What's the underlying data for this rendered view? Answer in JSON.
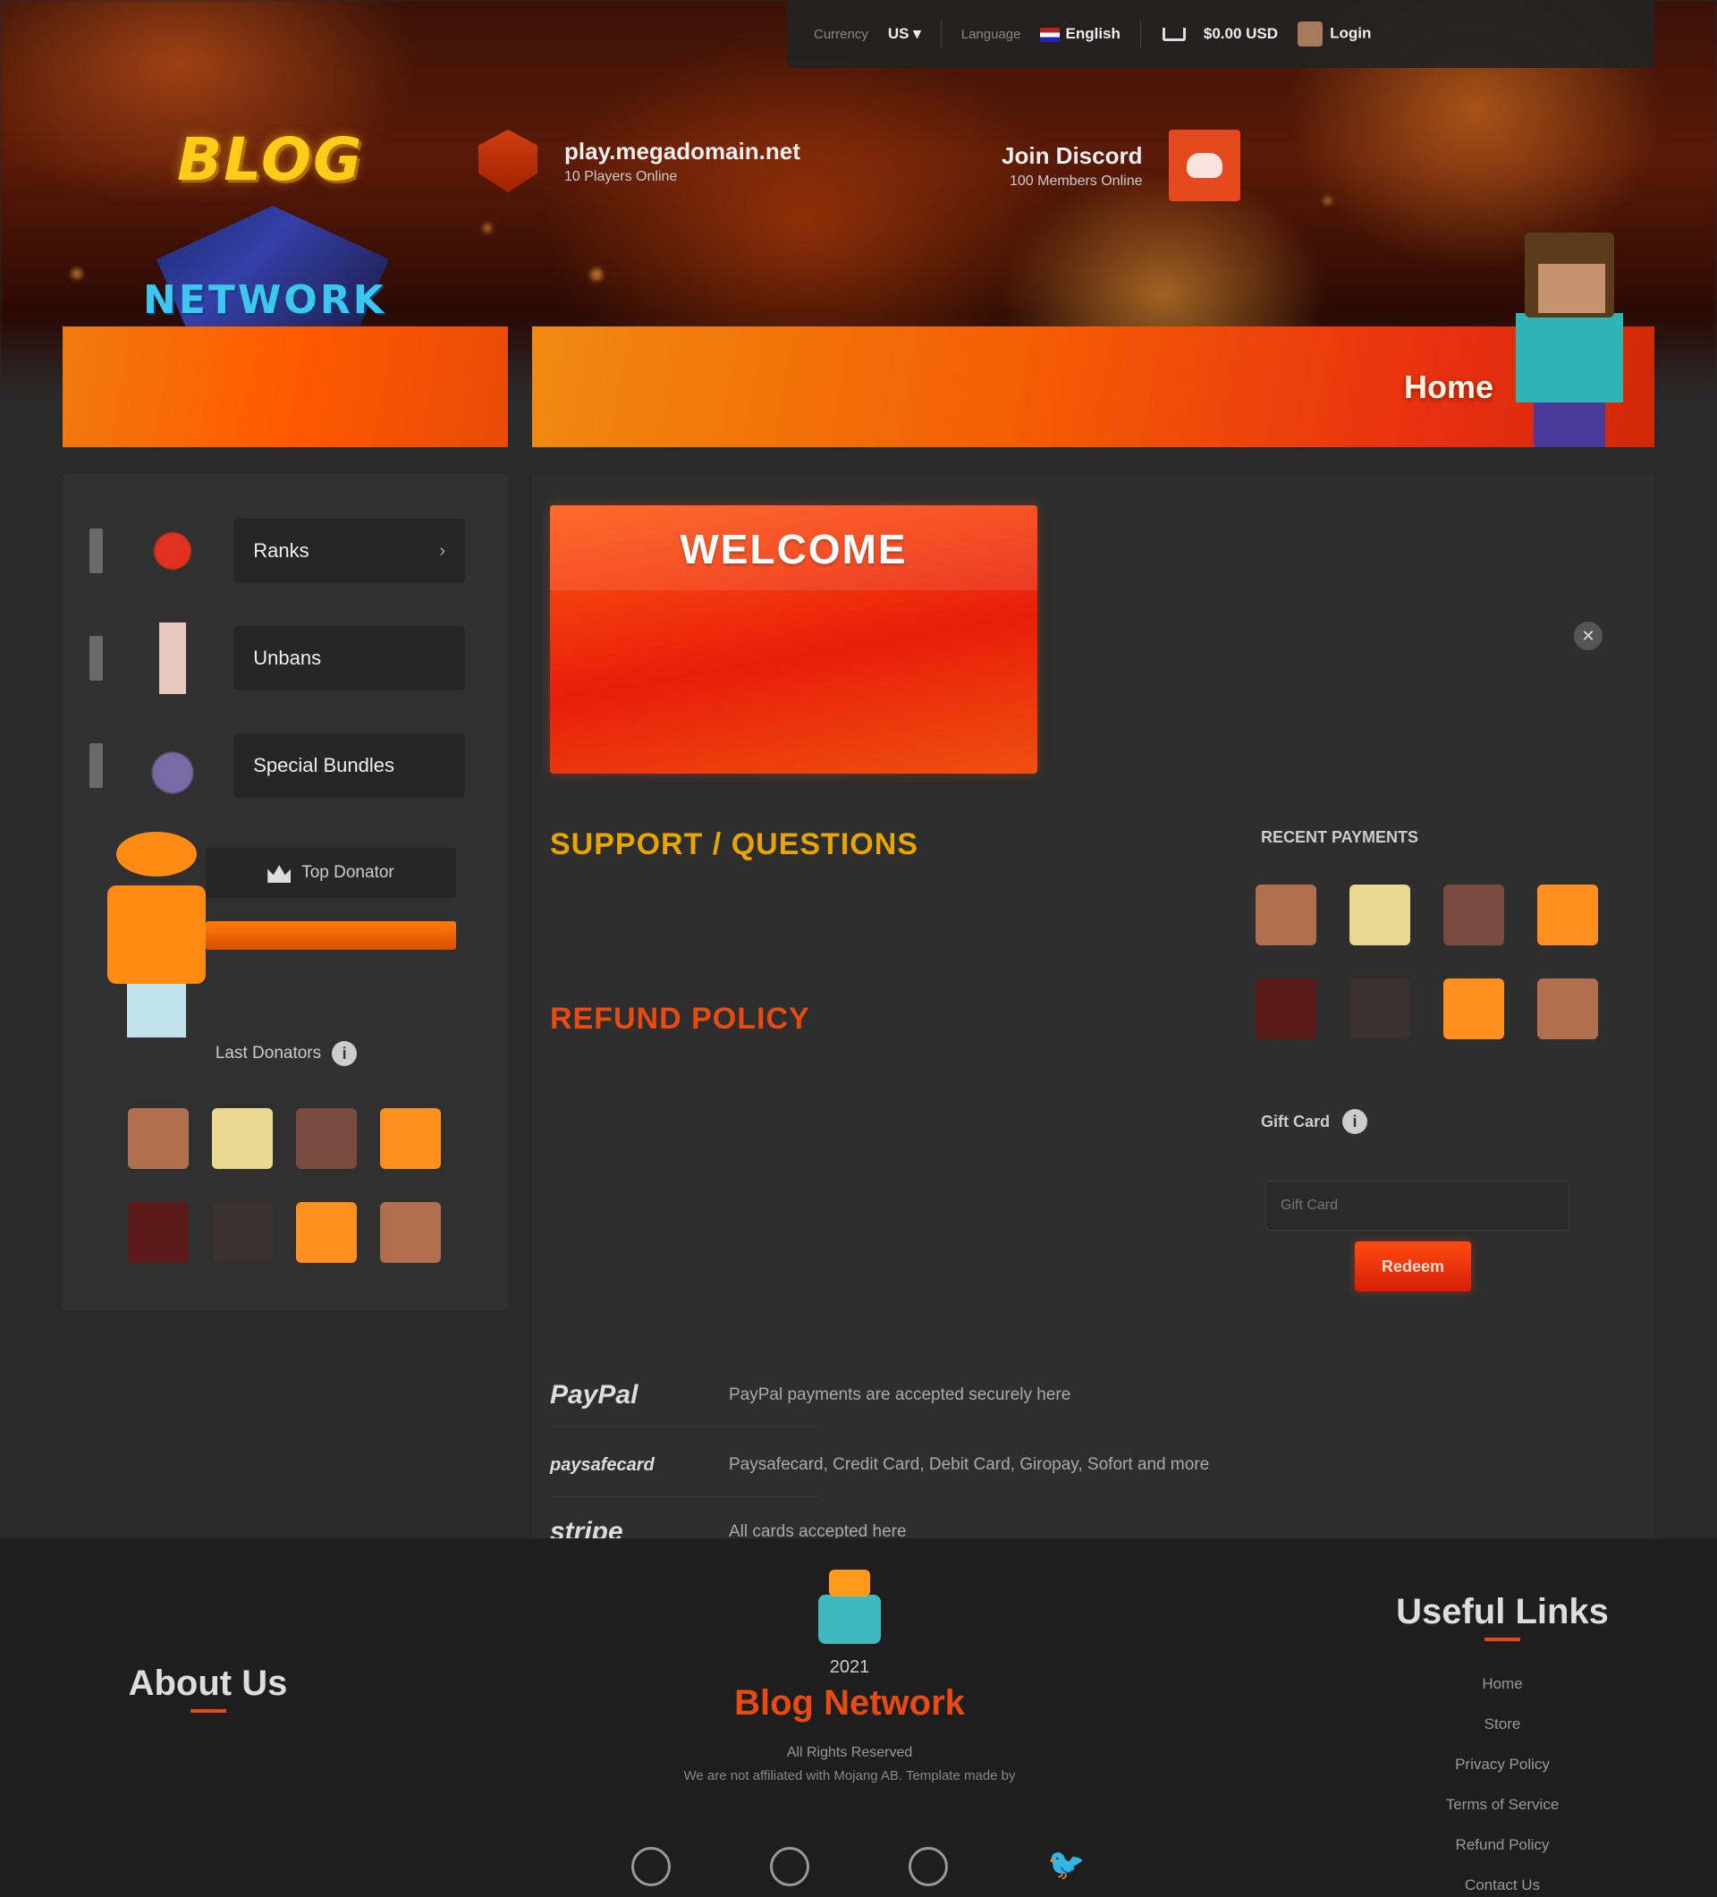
{
  "topbar": {
    "currency_label": "Currency",
    "currency_value": "US ▾",
    "language_label": "Language",
    "language_value": "English",
    "cart_value": "$0.00 USD",
    "login_label": "Login"
  },
  "header": {
    "logo_title": "BLOG",
    "logo_sub": "NETWORK",
    "server_ip": "play.megadomain.net",
    "server_sub": "10 Players Online",
    "discord_title": "Join Discord",
    "discord_sub": "100 Members Online",
    "banner_title": "Home"
  },
  "sidebar": {
    "categories": [
      {
        "label": "Ranks",
        "has_chevron": true,
        "color": "#c0281a"
      },
      {
        "label": "Unbans",
        "has_chevron": false,
        "color": "#e8c8c0"
      },
      {
        "label": "Special Bundles",
        "has_chevron": false,
        "color": "#7a6aa8"
      }
    ],
    "top_donator_label": "Top Donator",
    "top_donator_name": "",
    "top_donator_note": "",
    "latest_donators_label": "Last Donators"
  },
  "main": {
    "welcome_title": "WELCOME",
    "welcome_text": "",
    "welcome_text2": "",
    "support_title": "SUPPORT / QUESTIONS",
    "support_text": "",
    "refund_title": "REFUND POLICY",
    "refund_text": "",
    "refund_warning": "",
    "recent_title": "RECENT PAYMENTS",
    "gift_label": "Gift Card",
    "gift_placeholder": "Gift Card",
    "gift_button": "Redeem",
    "payments": [
      {
        "logo": "PayPal",
        "text": "PayPal payments are accepted securely here"
      },
      {
        "logo": "paysafecard",
        "text": "Paysafecard, Credit Card, Debit Card, Giropay, Sofort and more"
      },
      {
        "logo": "stripe",
        "text": "All cards accepted here"
      }
    ]
  },
  "footer": {
    "about_title": "About Us",
    "about_text": "",
    "year": "2021",
    "brand": "Blog Network",
    "rights": "All Rights Reserved",
    "disclaimer": "We are not affiliated with Mojang AB. Template made by",
    "disclaimer_link": "",
    "links_title": "Useful Links",
    "links": [
      "Home",
      "Store",
      "Privacy Policy",
      "Terms of Service",
      "Refund Policy",
      "Contact Us"
    ]
  },
  "donor_heads": [
    "#b07050",
    "#e8d890",
    "#7a4a40",
    "#ff9020",
    "#5a1a1a",
    "#3a3030",
    "#ff9020",
    "#b07050"
  ]
}
